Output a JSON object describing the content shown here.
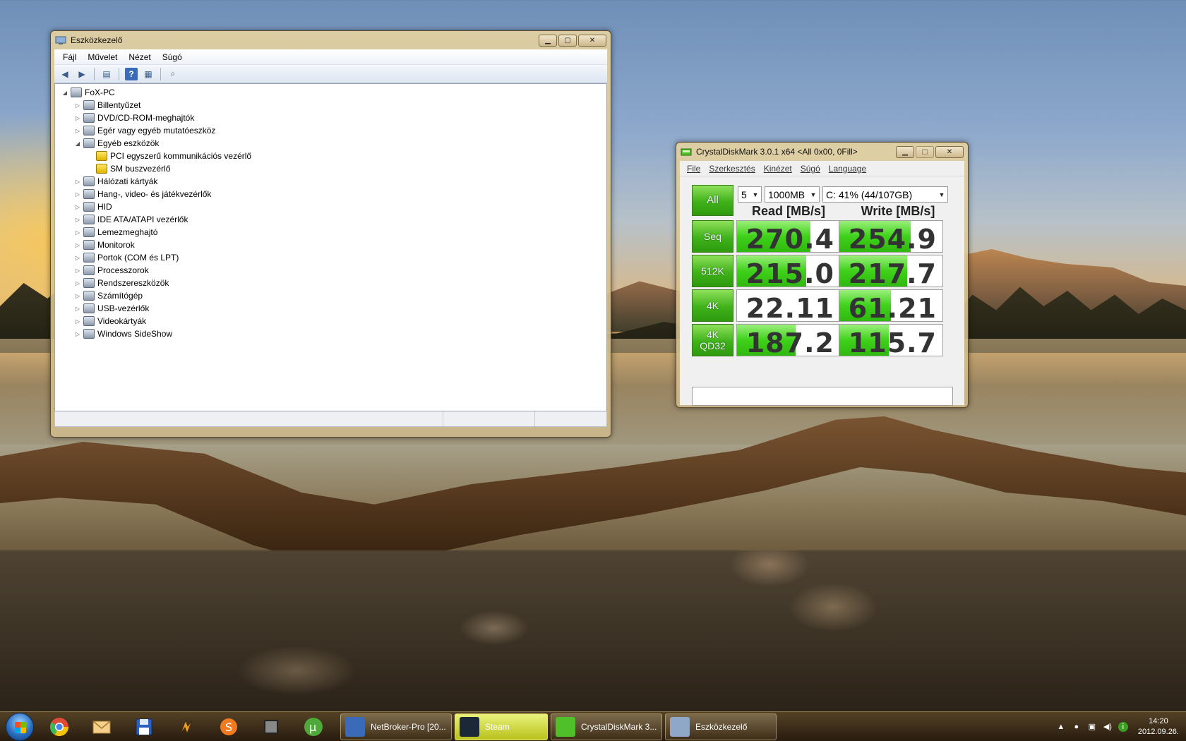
{
  "device_manager": {
    "title": "Eszközkezelő",
    "menu": [
      "Fájl",
      "Művelet",
      "Nézet",
      "Súgó"
    ],
    "toolbar_icons": [
      "back-arrow-icon",
      "forward-arrow-icon",
      "console-tree-icon",
      "help-icon",
      "properties-icon",
      "scan-hardware-icon"
    ],
    "tree": [
      {
        "label": "FoX-PC",
        "level": 0,
        "expander": "◢",
        "icon": "computer-icon"
      },
      {
        "label": "Billentyűzet",
        "level": 1,
        "expander": "▷",
        "icon": "keyboard-icon"
      },
      {
        "label": "DVD/CD-ROM-meghajtók",
        "level": 1,
        "expander": "▷",
        "icon": "dvd-drive-icon"
      },
      {
        "label": "Egér vagy egyéb mutatóeszköz",
        "level": 1,
        "expander": "▷",
        "icon": "mouse-icon"
      },
      {
        "label": "Egyéb eszközök",
        "level": 1,
        "expander": "◢",
        "icon": "other-devices-icon"
      },
      {
        "label": "PCI egyszerű kommunikációs vezérlő",
        "level": 2,
        "expander": "",
        "icon": "warning-device-icon",
        "warn": true
      },
      {
        "label": "SM buszvezérlő",
        "level": 2,
        "expander": "",
        "icon": "warning-device-icon",
        "warn": true
      },
      {
        "label": "Hálózati kártyák",
        "level": 1,
        "expander": "▷",
        "icon": "network-adapter-icon"
      },
      {
        "label": "Hang-, video- és játékvezérlők",
        "level": 1,
        "expander": "▷",
        "icon": "sound-icon"
      },
      {
        "label": "HID",
        "level": 1,
        "expander": "▷",
        "icon": "hid-icon"
      },
      {
        "label": "IDE ATA/ATAPI vezérlők",
        "level": 1,
        "expander": "▷",
        "icon": "ide-controller-icon"
      },
      {
        "label": "Lemezmeghajtó",
        "level": 1,
        "expander": "▷",
        "icon": "disk-drive-icon"
      },
      {
        "label": "Monitorok",
        "level": 1,
        "expander": "▷",
        "icon": "monitor-icon"
      },
      {
        "label": "Portok (COM és LPT)",
        "level": 1,
        "expander": "▷",
        "icon": "port-icon"
      },
      {
        "label": "Processzorok",
        "level": 1,
        "expander": "▷",
        "icon": "processor-icon"
      },
      {
        "label": "Rendszereszközök",
        "level": 1,
        "expander": "▷",
        "icon": "system-devices-icon"
      },
      {
        "label": "Számítógép",
        "level": 1,
        "expander": "▷",
        "icon": "computer-icon"
      },
      {
        "label": "USB-vezérlők",
        "level": 1,
        "expander": "▷",
        "icon": "usb-icon"
      },
      {
        "label": "Videokártyák",
        "level": 1,
        "expander": "▷",
        "icon": "display-adapter-icon"
      },
      {
        "label": "Windows SideShow",
        "level": 1,
        "expander": "▷",
        "icon": "sideshow-icon"
      }
    ]
  },
  "crystal": {
    "title": "CrystalDiskMark 3.0.1 x64 <All 0x00, 0Fill>",
    "menu": [
      "File",
      "Szerkesztés",
      "Kinézet",
      "Súgó",
      "Language"
    ],
    "all_label": "All",
    "count": "5",
    "size": "1000MB",
    "drive": "C: 41% (44/107GB)",
    "read_header": "Read [MB/s]",
    "write_header": "Write [MB/s]",
    "rows": [
      {
        "label": "Seq",
        "read": "270.4",
        "write": "254.9",
        "read_fill": 0.71,
        "write_fill": 0.69
      },
      {
        "label": "512K",
        "read": "215.0",
        "write": "217.7",
        "read_fill": 0.67,
        "write_fill": 0.66
      },
      {
        "label": "4K",
        "read": "22.11",
        "write": "61.21",
        "read_fill": 0.0,
        "write_fill": 0.5
      },
      {
        "label": "4K\nQD32",
        "read": "187.2",
        "write": "115.7",
        "read_fill": 0.57,
        "write_fill": 0.48
      }
    ],
    "comment": ""
  },
  "taskbar": {
    "pinned": [
      "chrome-icon",
      "mail-icon",
      "save-disk-icon",
      "winamp-icon",
      "sublime-icon",
      "square-app-icon",
      "utorrent-icon"
    ],
    "tasks": [
      {
        "label": "NetBroker-Pro [20...",
        "icon": "chart-icon",
        "active": false
      },
      {
        "label": "Steam",
        "icon": "steam-icon",
        "active": true
      },
      {
        "label": "CrystalDiskMark 3...",
        "icon": "crystaldiskmark-icon",
        "active": false
      },
      {
        "label": "Eszközkezelő",
        "icon": "device-manager-icon",
        "active": false
      }
    ],
    "time": "14:20",
    "date": "2012.09.26."
  }
}
